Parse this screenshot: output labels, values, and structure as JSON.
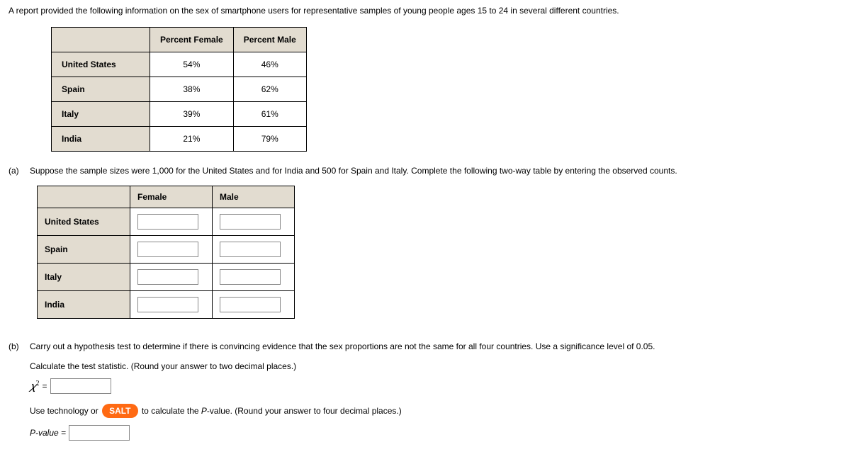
{
  "intro": "A report provided the following information on the sex of smartphone users for representative samples of young people ages 15 to 24 in several different countries.",
  "table1": {
    "headers": {
      "female": "Percent Female",
      "male": "Percent Male"
    },
    "rows": [
      {
        "country": "United States",
        "female": "54%",
        "male": "46%"
      },
      {
        "country": "Spain",
        "female": "38%",
        "male": "62%"
      },
      {
        "country": "Italy",
        "female": "39%",
        "male": "61%"
      },
      {
        "country": "India",
        "female": "21%",
        "male": "79%"
      }
    ]
  },
  "partA": {
    "label": "(a)",
    "text": "Suppose the sample sizes were 1,000 for the United States and for India and 500 for Spain and Italy. Complete the following two-way table by entering the observed counts.",
    "headers": {
      "female": "Female",
      "male": "Male"
    },
    "rows": [
      {
        "country": "United States"
      },
      {
        "country": "Spain"
      },
      {
        "country": "Italy"
      },
      {
        "country": "India"
      }
    ]
  },
  "partB": {
    "label": "(b)",
    "text": "Carry out a hypothesis test to determine if there is convincing evidence that the sex proportions are not the same for all four countries. Use a significance level of 0.05.",
    "calc": "Calculate the test statistic. (Round your answer to two decimal places.)",
    "chiLabel": "𝜒",
    "chiSup": "2",
    "equals": " = ",
    "salt_pre": "Use technology or ",
    "salt": "SALT",
    "salt_post": " to calculate the P-value. (Round your answer to four decimal places.)",
    "pLabel": "P-value = "
  }
}
